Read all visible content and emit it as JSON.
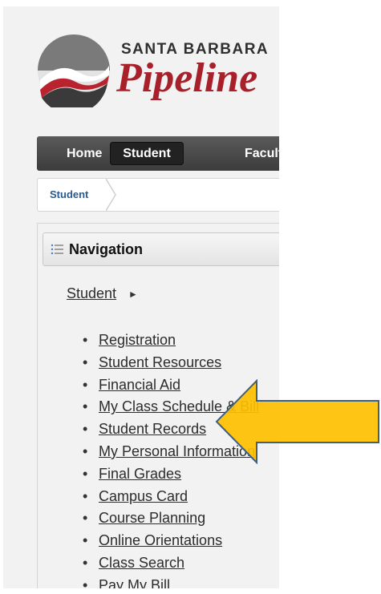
{
  "brand": {
    "top_text": "SANTA BARBARA",
    "main_text": "Pipeline",
    "logo_icon": "pipeline-wave-logo"
  },
  "topnav": {
    "tabs": [
      {
        "label": "Home",
        "active": false
      },
      {
        "label": "Student",
        "active": true
      },
      {
        "label": "Faculty",
        "active": false
      }
    ]
  },
  "breadcrumb": {
    "items": [
      "Student"
    ]
  },
  "navigation": {
    "title": "Navigation",
    "title_icon": "list-icon",
    "section_link": "Student",
    "section_arrow": "►",
    "items": [
      "Registration",
      "Student Resources",
      "Financial Aid",
      "My Class Schedule & Bill",
      "Student Records",
      "My Personal Information",
      "Final Grades",
      "Campus Card",
      "Course Planning",
      "Online Orientations",
      "Class Search",
      "Pay My Bill"
    ]
  },
  "colors": {
    "brand_red": "#a8202a",
    "nav_dark": "#3c3c3c",
    "callout_fill": "#ffc000",
    "callout_stroke": "#3e5e82"
  }
}
